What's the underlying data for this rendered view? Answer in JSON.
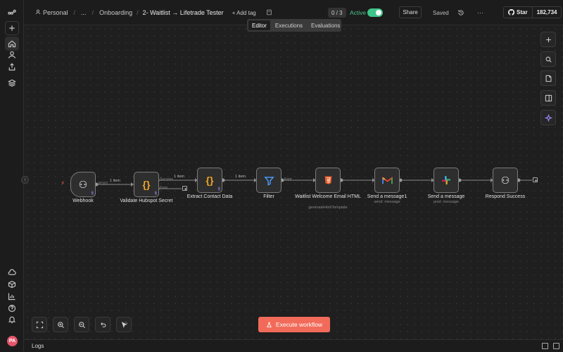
{
  "header": {
    "crumbs": [
      "Personal",
      "...",
      "Onboarding",
      "2- Waitlist → Lifetrade Tester"
    ],
    "separator": "/",
    "add_tag": "+ Add tag",
    "counter": "0 / 3",
    "active_label": "Active",
    "active_on": true,
    "share": "Share",
    "saved": "Saved",
    "more": "···",
    "github_star": "Star",
    "github_count": "182,734"
  },
  "tabs": [
    {
      "label": "Editor",
      "active": true
    },
    {
      "label": "Executions",
      "active": false
    },
    {
      "label": "Evaluations",
      "active": false
    }
  ],
  "nodes": [
    {
      "id": "webhook",
      "label": "Webhook",
      "sub": "",
      "icon": "webhook-icon",
      "glyph": "⚇",
      "color": "#ffffff",
      "badge": "§"
    },
    {
      "id": "validate",
      "label": "Validate Hubspot Secret",
      "sub": "",
      "icon": "code-icon",
      "glyph": "{}",
      "color": "#f0a623",
      "badge": "§"
    },
    {
      "id": "extract",
      "label": "Extract Contact Data",
      "sub": "",
      "icon": "code-icon",
      "glyph": "{}",
      "color": "#f0a623",
      "badge": "§"
    },
    {
      "id": "filter",
      "label": "Filter",
      "sub": "",
      "icon": "filter-icon",
      "glyph": "⏷",
      "color": "#4a9eff",
      "badge": ""
    },
    {
      "id": "html",
      "label": "Waitlist Welcome Email HTML",
      "sub": "generateHtmlTemplate",
      "icon": "html5-icon",
      "glyph": "5",
      "color": "#e85d2a",
      "badge": ""
    },
    {
      "id": "gmail",
      "label": "Send a message1",
      "sub": "send: message",
      "icon": "gmail-icon",
      "glyph": "M",
      "color": "#ea4335",
      "badge": ""
    },
    {
      "id": "slack",
      "label": "Send a message",
      "sub": "post: message",
      "icon": "slack-icon",
      "glyph": "#",
      "color": "#36c5f0",
      "badge": ""
    },
    {
      "id": "respond",
      "label": "Respond Success",
      "sub": "",
      "icon": "webhook-icon",
      "glyph": "⚇",
      "color": "#ffffff",
      "badge": ""
    }
  ],
  "edge_labels": {
    "webhook_validate": "1 item",
    "validate_extract": "1 item",
    "extract_filter": "1 item",
    "port_post": "POST",
    "port_success": "Success",
    "port_error": "Error",
    "port_kept": "Kept"
  },
  "execute_button": "Execute workflow",
  "logs_label": "Logs",
  "user_initials": "PA"
}
